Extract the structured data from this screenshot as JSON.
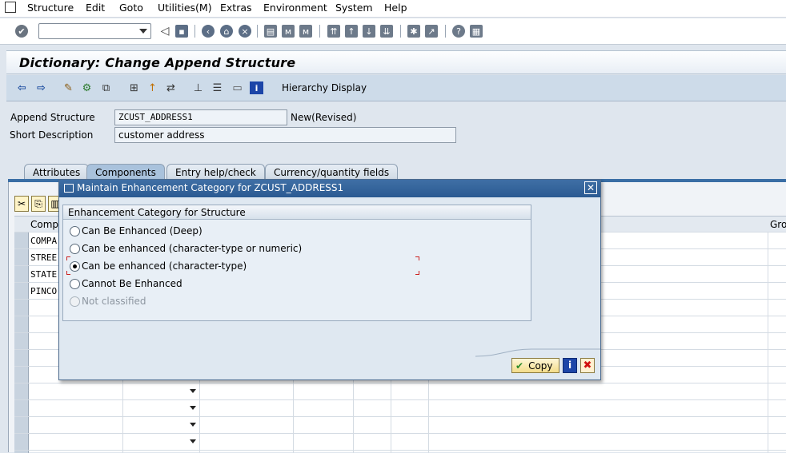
{
  "menu": {
    "items": [
      "Structure",
      "Edit",
      "Goto",
      "Utilities(M)",
      "Extras",
      "Environment",
      "System",
      "Help"
    ]
  },
  "page": {
    "title": "Dictionary: Change Append Structure"
  },
  "app_toolbar": {
    "hierarchy_display_label": "Hierarchy Display"
  },
  "form": {
    "append_structure_label": "Append Structure",
    "append_structure_value": "ZCUST_ADDRESS1",
    "status": "New(Revised)",
    "short_description_label": "Short Description",
    "short_description_value": "customer address"
  },
  "tabs": [
    "Attributes",
    "Components",
    "Entry help/check",
    "Currency/quantity fields"
  ],
  "active_tab": "Components",
  "table": {
    "header_component": "Compo",
    "header_right": "Gro",
    "rows": [
      "COMPA",
      "STREE",
      "STATE",
      "PINCO"
    ]
  },
  "dialog": {
    "title": "Maintain Enhancement Category for ZCUST_ADDRESS1",
    "group_title": "Enhancement Category for Structure",
    "options": [
      {
        "label": "Can Be Enhanced (Deep)",
        "checked": false,
        "disabled": false
      },
      {
        "label": "Can be enhanced (character-type or numeric)",
        "checked": false,
        "disabled": false
      },
      {
        "label": "Can be enhanced (character-type)",
        "checked": true,
        "disabled": false
      },
      {
        "label": "Cannot Be Enhanced",
        "checked": false,
        "disabled": false
      },
      {
        "label": "Not classified",
        "checked": false,
        "disabled": true
      }
    ],
    "copy_label": "Copy"
  },
  "colors": {
    "title_bar_blue": "#2b5a92",
    "app_toolbar_bg": "#cddbe9",
    "focus_red": "#cc2020"
  }
}
